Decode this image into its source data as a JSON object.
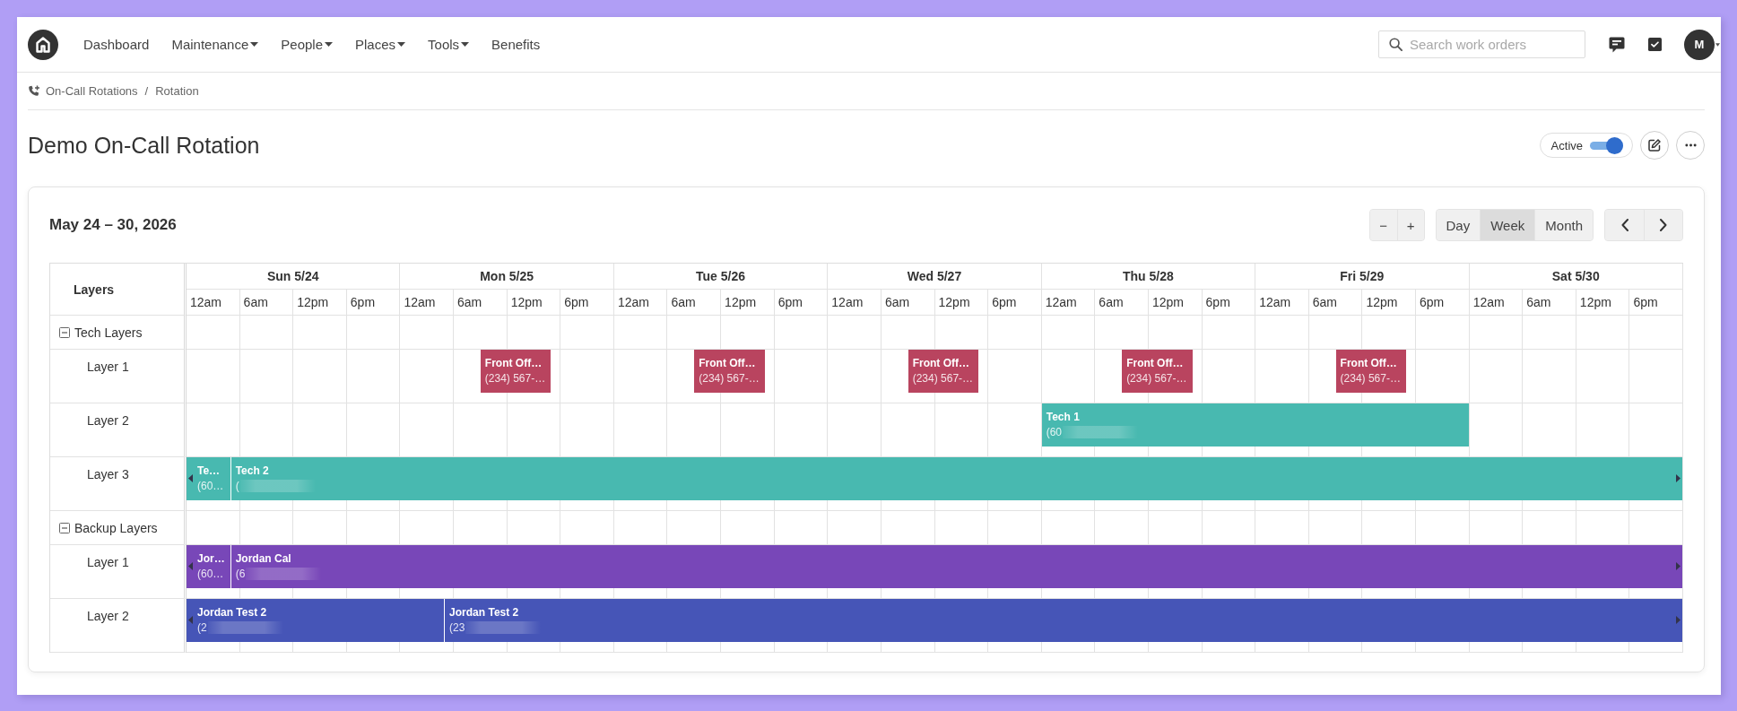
{
  "nav": {
    "items": [
      {
        "label": "Dashboard",
        "has_menu": false
      },
      {
        "label": "Maintenance",
        "has_menu": true
      },
      {
        "label": "People",
        "has_menu": true
      },
      {
        "label": "Places",
        "has_menu": true
      },
      {
        "label": "Tools",
        "has_menu": true
      },
      {
        "label": "Benefits",
        "has_menu": false
      }
    ],
    "search": {
      "placeholder": "Search work orders"
    },
    "user": {
      "initial": "M"
    }
  },
  "breadcrumb": {
    "items": [
      "On-Call Rotations",
      "Rotation"
    ],
    "separator": "/"
  },
  "page": {
    "title": "Demo On-Call Rotation",
    "status": {
      "label": "Active",
      "on": true
    }
  },
  "calendar": {
    "range_label": "May 24 – 30, 2026",
    "zoom_buttons": [
      "−",
      "+"
    ],
    "views": [
      {
        "label": "Day",
        "selected": false
      },
      {
        "label": "Week",
        "selected": true
      },
      {
        "label": "Month",
        "selected": false
      }
    ],
    "layers_heading": "Layers",
    "days": [
      {
        "label": "Sun 5/24",
        "hours": [
          "12am",
          "6am",
          "12pm",
          "6pm"
        ]
      },
      {
        "label": "Mon 5/25",
        "hours": [
          "12am",
          "6am",
          "12pm",
          "6pm"
        ]
      },
      {
        "label": "Tue 5/26",
        "hours": [
          "12am",
          "6am",
          "12pm",
          "6pm"
        ]
      },
      {
        "label": "Wed 5/27",
        "hours": [
          "12am",
          "6am",
          "12pm",
          "6pm"
        ]
      },
      {
        "label": "Thu 5/28",
        "hours": [
          "12am",
          "6am",
          "12pm",
          "6pm"
        ]
      },
      {
        "label": "Fri 5/29",
        "hours": [
          "12am",
          "6am",
          "12pm",
          "6pm"
        ]
      },
      {
        "label": "Sat 5/30",
        "hours": [
          "12am",
          "6am",
          "12pm",
          "6pm"
        ]
      }
    ],
    "groups": [
      {
        "label": "Tech Layers",
        "expanded": true,
        "layers": [
          {
            "label": "Layer 1",
            "events": [
              {
                "title": "Front Off…",
                "phone": "(234) 567-…",
                "color": "#b9445f",
                "continues_before": false,
                "continues_after": false,
                "phone_blurred": false
              },
              {
                "title": "Front Off…",
                "phone": "(234) 567-…",
                "color": "#b9445f",
                "continues_before": false,
                "continues_after": false,
                "phone_blurred": false
              },
              {
                "title": "Front Off…",
                "phone": "(234) 567-…",
                "color": "#b9445f",
                "continues_before": false,
                "continues_after": false,
                "phone_blurred": false
              },
              {
                "title": "Front Off…",
                "phone": "(234) 567-…",
                "color": "#b9445f",
                "continues_before": false,
                "continues_after": false,
                "phone_blurred": false
              },
              {
                "title": "Front Off…",
                "phone": "(234) 567-…",
                "color": "#b9445f",
                "continues_before": false,
                "continues_after": false,
                "phone_blurred": false
              }
            ]
          },
          {
            "label": "Layer 2",
            "events": [
              {
                "title": "Tech 1",
                "phone": "(60",
                "color": "#48b9b0",
                "continues_before": false,
                "continues_after": false,
                "phone_blurred": true
              }
            ]
          },
          {
            "label": "Layer 3",
            "events": [
              {
                "title": "Te…",
                "phone": "(60…",
                "color": "#48b9b0",
                "continues_before": true,
                "continues_after": false,
                "phone_blurred": false
              },
              {
                "title": "Tech 2",
                "phone": "(",
                "color": "#48b9b0",
                "continues_before": false,
                "continues_after": true,
                "phone_blurred": true
              }
            ]
          }
        ]
      },
      {
        "label": "Backup Layers",
        "expanded": true,
        "layers": [
          {
            "label": "Layer 1",
            "events": [
              {
                "title": "Jor…",
                "phone": "(60…",
                "color": "#7847b8",
                "continues_before": true,
                "continues_after": false,
                "phone_blurred": false
              },
              {
                "title": "Jordan Cal",
                "phone": "(6",
                "color": "#7847b8",
                "continues_before": false,
                "continues_after": true,
                "phone_blurred": true
              }
            ]
          },
          {
            "label": "Layer 2",
            "events": [
              {
                "title": "Jordan Test 2",
                "phone": "(2",
                "color": "#4655b7",
                "continues_before": true,
                "continues_after": false,
                "phone_blurred": true
              },
              {
                "title": "Jordan Test 2",
                "phone": "(23",
                "color": "#4655b7",
                "continues_before": false,
                "continues_after": true,
                "phone_blurred": true
              }
            ]
          }
        ]
      }
    ]
  }
}
